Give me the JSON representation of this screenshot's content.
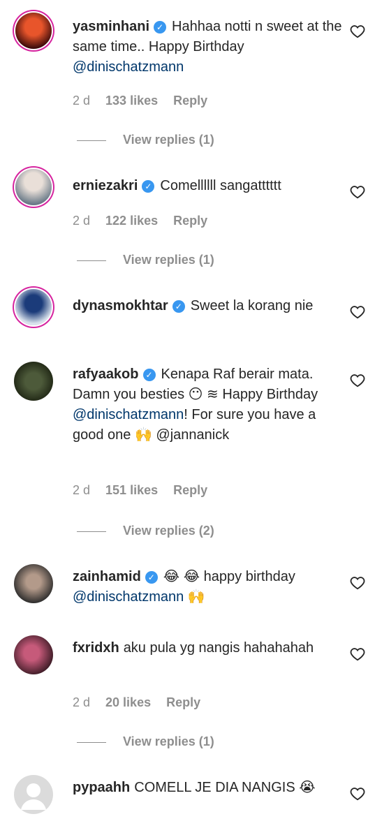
{
  "comments": [
    {
      "user": "yasminhani",
      "text": "Hahhaa notti n sweet at the same time.. Happy Birthday ",
      "mention": "@dinischatzmann",
      "tail": "",
      "age": "2 d",
      "likes": "133 likes",
      "reply": "Reply",
      "replies": "View replies (1)"
    },
    {
      "user": "erniezakri",
      "text": "Comellllll sangatttttt",
      "mention": "",
      "tail": "",
      "age": "2 d",
      "likes": "122 likes",
      "reply": "Reply",
      "replies": "View replies (1)"
    },
    {
      "user": "dynasmokhtar",
      "text": "Sweet la korang nie",
      "mention": "",
      "tail": ""
    },
    {
      "user": "rafyaakob",
      "text": "Kenapa Raf berair mata. Damn you besties 😶 ≋ Happy Birthday ",
      "mention": "@dinischatzmann",
      "tail": "! For sure you have a good one 🙌 @jannanick",
      "age": "2 d",
      "likes": "151 likes",
      "reply": "Reply",
      "replies": "View replies (2)"
    },
    {
      "user": "zainhamid",
      "text": "😂 😂 happy birthday ",
      "mention": "@dinischatzmann",
      "tail": " 🙌"
    },
    {
      "user": "fxridxh",
      "text": "aku pula yg nangis hahahahah",
      "mention": "",
      "tail": "",
      "age": "2 d",
      "likes": "20 likes",
      "reply": "Reply",
      "replies": "View replies (1)"
    },
    {
      "user": "pypaahh",
      "text": "COMELL JE DIA NANGIS 😭",
      "mention": "",
      "tail": ""
    }
  ]
}
